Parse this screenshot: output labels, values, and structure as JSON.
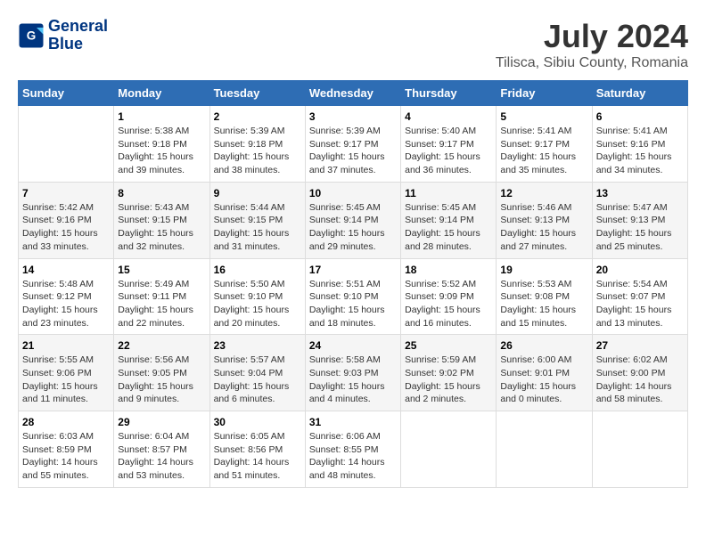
{
  "logo": {
    "line1": "General",
    "line2": "Blue"
  },
  "title": "July 2024",
  "subtitle": "Tilisca, Sibiu County, Romania",
  "weekdays": [
    "Sunday",
    "Monday",
    "Tuesday",
    "Wednesday",
    "Thursday",
    "Friday",
    "Saturday"
  ],
  "weeks": [
    [
      {
        "day": "",
        "info": ""
      },
      {
        "day": "1",
        "info": "Sunrise: 5:38 AM\nSunset: 9:18 PM\nDaylight: 15 hours\nand 39 minutes."
      },
      {
        "day": "2",
        "info": "Sunrise: 5:39 AM\nSunset: 9:18 PM\nDaylight: 15 hours\nand 38 minutes."
      },
      {
        "day": "3",
        "info": "Sunrise: 5:39 AM\nSunset: 9:17 PM\nDaylight: 15 hours\nand 37 minutes."
      },
      {
        "day": "4",
        "info": "Sunrise: 5:40 AM\nSunset: 9:17 PM\nDaylight: 15 hours\nand 36 minutes."
      },
      {
        "day": "5",
        "info": "Sunrise: 5:41 AM\nSunset: 9:17 PM\nDaylight: 15 hours\nand 35 minutes."
      },
      {
        "day": "6",
        "info": "Sunrise: 5:41 AM\nSunset: 9:16 PM\nDaylight: 15 hours\nand 34 minutes."
      }
    ],
    [
      {
        "day": "7",
        "info": "Sunrise: 5:42 AM\nSunset: 9:16 PM\nDaylight: 15 hours\nand 33 minutes."
      },
      {
        "day": "8",
        "info": "Sunrise: 5:43 AM\nSunset: 9:15 PM\nDaylight: 15 hours\nand 32 minutes."
      },
      {
        "day": "9",
        "info": "Sunrise: 5:44 AM\nSunset: 9:15 PM\nDaylight: 15 hours\nand 31 minutes."
      },
      {
        "day": "10",
        "info": "Sunrise: 5:45 AM\nSunset: 9:14 PM\nDaylight: 15 hours\nand 29 minutes."
      },
      {
        "day": "11",
        "info": "Sunrise: 5:45 AM\nSunset: 9:14 PM\nDaylight: 15 hours\nand 28 minutes."
      },
      {
        "day": "12",
        "info": "Sunrise: 5:46 AM\nSunset: 9:13 PM\nDaylight: 15 hours\nand 27 minutes."
      },
      {
        "day": "13",
        "info": "Sunrise: 5:47 AM\nSunset: 9:13 PM\nDaylight: 15 hours\nand 25 minutes."
      }
    ],
    [
      {
        "day": "14",
        "info": "Sunrise: 5:48 AM\nSunset: 9:12 PM\nDaylight: 15 hours\nand 23 minutes."
      },
      {
        "day": "15",
        "info": "Sunrise: 5:49 AM\nSunset: 9:11 PM\nDaylight: 15 hours\nand 22 minutes."
      },
      {
        "day": "16",
        "info": "Sunrise: 5:50 AM\nSunset: 9:10 PM\nDaylight: 15 hours\nand 20 minutes."
      },
      {
        "day": "17",
        "info": "Sunrise: 5:51 AM\nSunset: 9:10 PM\nDaylight: 15 hours\nand 18 minutes."
      },
      {
        "day": "18",
        "info": "Sunrise: 5:52 AM\nSunset: 9:09 PM\nDaylight: 15 hours\nand 16 minutes."
      },
      {
        "day": "19",
        "info": "Sunrise: 5:53 AM\nSunset: 9:08 PM\nDaylight: 15 hours\nand 15 minutes."
      },
      {
        "day": "20",
        "info": "Sunrise: 5:54 AM\nSunset: 9:07 PM\nDaylight: 15 hours\nand 13 minutes."
      }
    ],
    [
      {
        "day": "21",
        "info": "Sunrise: 5:55 AM\nSunset: 9:06 PM\nDaylight: 15 hours\nand 11 minutes."
      },
      {
        "day": "22",
        "info": "Sunrise: 5:56 AM\nSunset: 9:05 PM\nDaylight: 15 hours\nand 9 minutes."
      },
      {
        "day": "23",
        "info": "Sunrise: 5:57 AM\nSunset: 9:04 PM\nDaylight: 15 hours\nand 6 minutes."
      },
      {
        "day": "24",
        "info": "Sunrise: 5:58 AM\nSunset: 9:03 PM\nDaylight: 15 hours\nand 4 minutes."
      },
      {
        "day": "25",
        "info": "Sunrise: 5:59 AM\nSunset: 9:02 PM\nDaylight: 15 hours\nand 2 minutes."
      },
      {
        "day": "26",
        "info": "Sunrise: 6:00 AM\nSunset: 9:01 PM\nDaylight: 15 hours\nand 0 minutes."
      },
      {
        "day": "27",
        "info": "Sunrise: 6:02 AM\nSunset: 9:00 PM\nDaylight: 14 hours\nand 58 minutes."
      }
    ],
    [
      {
        "day": "28",
        "info": "Sunrise: 6:03 AM\nSunset: 8:59 PM\nDaylight: 14 hours\nand 55 minutes."
      },
      {
        "day": "29",
        "info": "Sunrise: 6:04 AM\nSunset: 8:57 PM\nDaylight: 14 hours\nand 53 minutes."
      },
      {
        "day": "30",
        "info": "Sunrise: 6:05 AM\nSunset: 8:56 PM\nDaylight: 14 hours\nand 51 minutes."
      },
      {
        "day": "31",
        "info": "Sunrise: 6:06 AM\nSunset: 8:55 PM\nDaylight: 14 hours\nand 48 minutes."
      },
      {
        "day": "",
        "info": ""
      },
      {
        "day": "",
        "info": ""
      },
      {
        "day": "",
        "info": ""
      }
    ]
  ]
}
